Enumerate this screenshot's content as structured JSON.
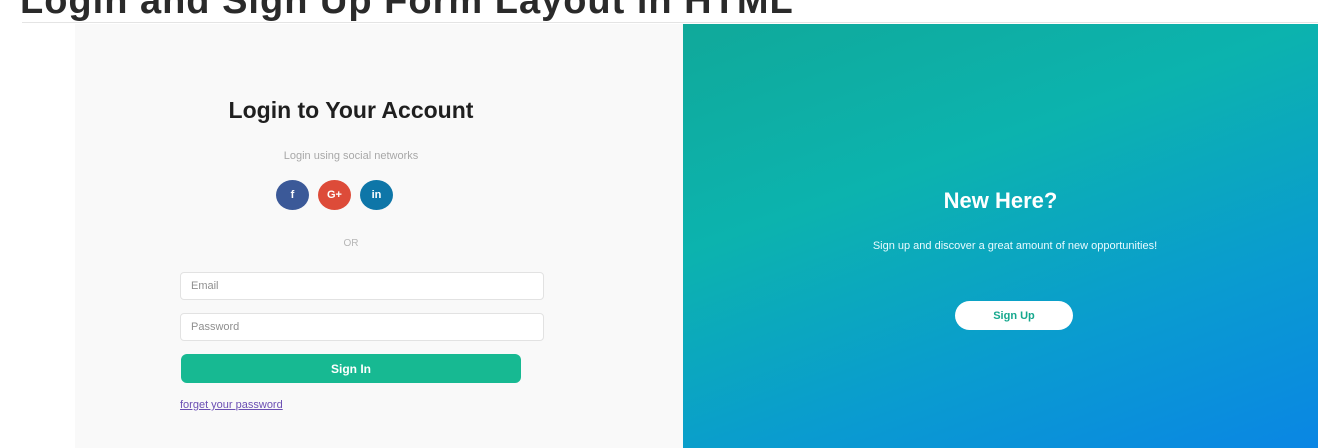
{
  "page": {
    "top_heading": "Login and Sign Up Form Layout in HTML",
    "colors": {
      "brand_green": "#17b992",
      "gradient_start": "#10a99a",
      "gradient_end": "#0a86e4",
      "facebook": "#3b5998",
      "google": "#dd4b39",
      "linkedin": "#0e76a8",
      "link": "#6b4fb3"
    }
  },
  "login": {
    "title": "Login to Your Account",
    "social_caption": "Login using social networks",
    "social": [
      {
        "label": "f",
        "icon": "facebook-icon",
        "color": "#3b5998"
      },
      {
        "label": "G+",
        "icon": "google-plus-icon",
        "color": "#dd4b39"
      },
      {
        "label": "in",
        "icon": "linkedin-icon",
        "color": "#0e76a8"
      }
    ],
    "or_text": "OR",
    "email_placeholder": "Email",
    "password_placeholder": "Password",
    "signin_label": "Sign In",
    "forgot_label": "forget your password"
  },
  "signup": {
    "title": "New Here?",
    "description": "Sign up and discover a great amount of new opportunities!",
    "button_label": "Sign Up"
  }
}
